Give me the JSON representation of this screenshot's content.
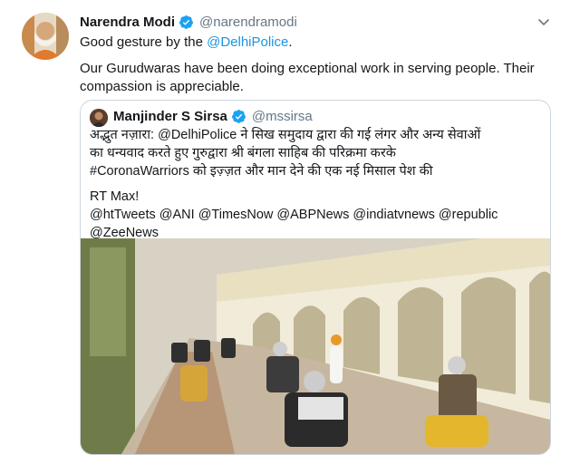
{
  "tweet": {
    "author_name": "Narendra Modi",
    "author_handle": "@narendramodi",
    "line1_prefix": "Good gesture by the ",
    "line1_mention": "@DelhiPolice",
    "line1_suffix": ".",
    "line2": "Our Gurudwaras have been doing exceptional work in serving people. Their",
    "line3": "compassion is appreciable."
  },
  "quoted": {
    "author_name": "Manjinder S Sirsa",
    "author_handle": "@mssirsa",
    "line1": "अद्भुत नज़ारा: @DelhiPolice ने सिख समुदाय द्वारा की गई लंगर और अन्य सेवाओं",
    "line2": "का धन्यवाद करते हुए गुरुद्वारा श्री बंगला साहिब की परिक्रमा करके",
    "line3": "#CoronaWarriors को इज़्ज़त और मान देने की एक नई मिसाल पेश की",
    "line4": "RT Max!",
    "line5": "@htTweets @ANI @TimesNow @ABPNews @indiatvnews @republic",
    "line6": "@ZeeNews"
  },
  "icons": {
    "verified": "verified-badge-icon",
    "menu": "chevron-down-icon"
  },
  "colors": {
    "link": "#1b95e0",
    "verified": "#1da1f2",
    "muted": "#657786",
    "border": "#ccd6dd"
  }
}
